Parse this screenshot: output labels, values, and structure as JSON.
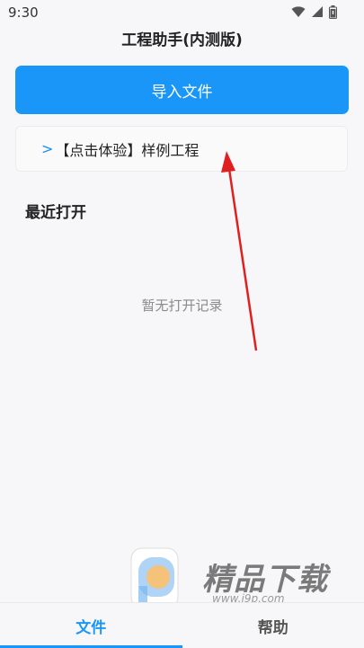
{
  "status_bar": {
    "time": "9:30",
    "icons": [
      "wifi-icon",
      "signal-icon",
      "battery-icon"
    ]
  },
  "app": {
    "title": "工程助手(内测版)"
  },
  "actions": {
    "import_label": "导入文件"
  },
  "sample": {
    "chevron": ">",
    "label": "【点击体验】样例工程"
  },
  "recent": {
    "heading": "最近打开",
    "empty_text": "暂无打开记录"
  },
  "watermark": {
    "brand": "精品下载",
    "url": "www.j9p.com"
  },
  "tabs": [
    {
      "label": "文件",
      "active": true
    },
    {
      "label": "帮助",
      "active": false
    }
  ],
  "colors": {
    "accent": "#1a96f8",
    "annotation_arrow": "#e02020"
  }
}
